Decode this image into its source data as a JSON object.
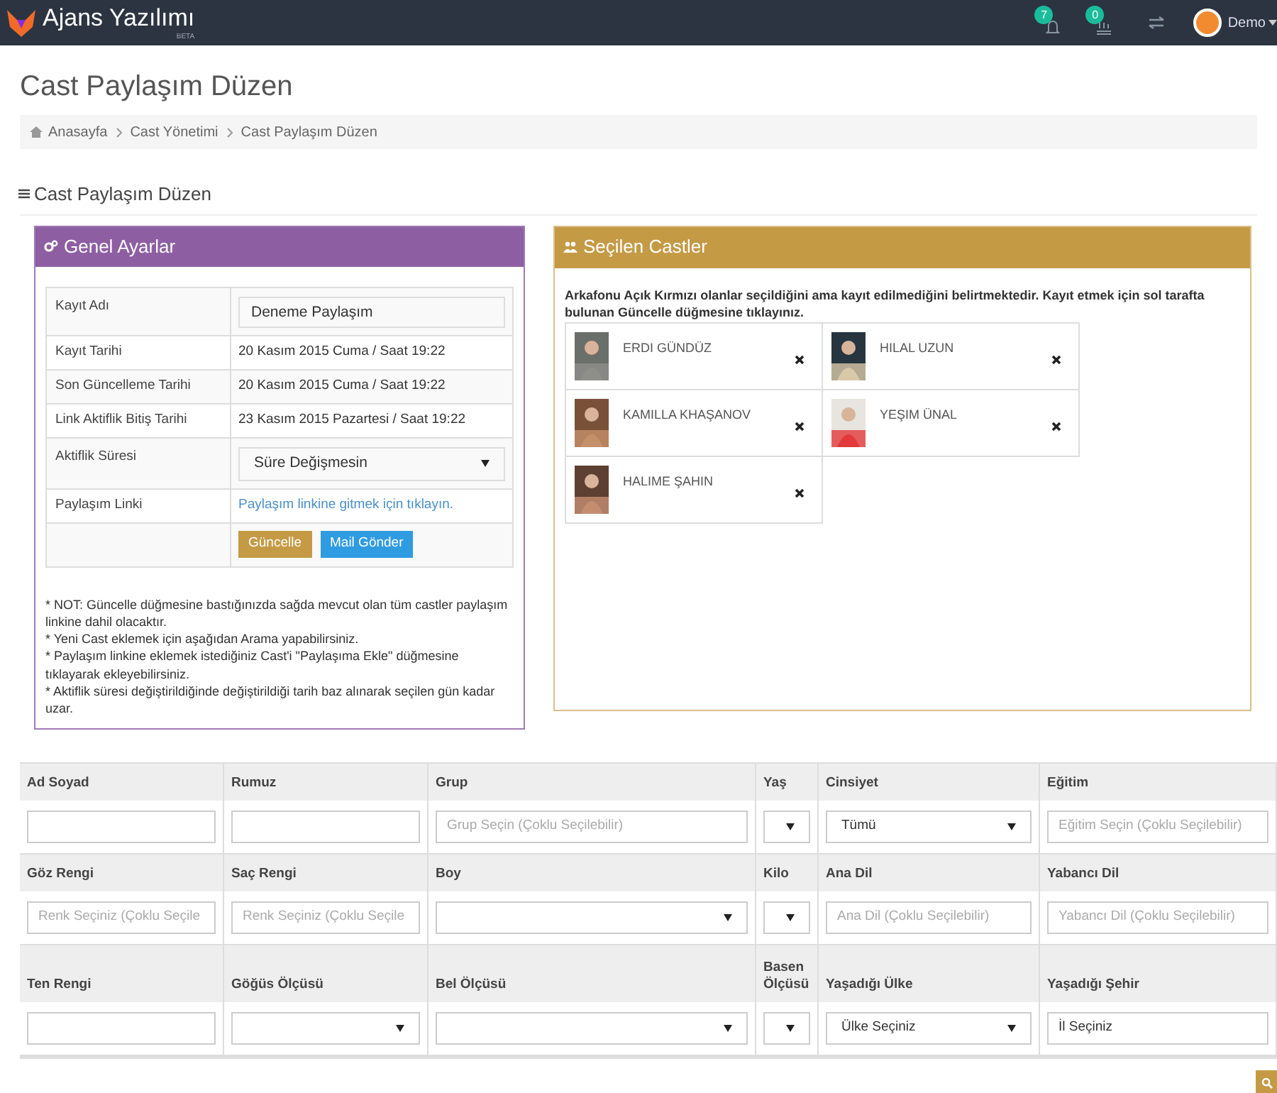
{
  "navbar": {
    "brand": "Ajans Yazılımı",
    "brand_badge": "BETA",
    "notifications": [
      {
        "count": "7"
      },
      {
        "count": "0"
      }
    ],
    "user": "Demo"
  },
  "page_title": "Cast Paylaşım Düzen",
  "breadcrumb": [
    "Anasayfa",
    "Cast Yönetimi",
    "Cast Paylaşım Düzen"
  ],
  "section_title": "Cast Paylaşım Düzen",
  "settings_panel": {
    "title": "Genel Ayarlar",
    "rows": [
      {
        "label": "Kayıt Adı",
        "kind": "input",
        "value": "Deneme Paylaşım"
      },
      {
        "label": "Kayıt Tarihi",
        "kind": "text",
        "value": "20 Kasım 2015 Cuma / Saat 19:22"
      },
      {
        "label": "Son Güncelleme Tarihi",
        "kind": "text",
        "value": "20 Kasım 2015 Cuma / Saat 19:22"
      },
      {
        "label": "Link Aktiflik Bitiş Tarihi",
        "kind": "text",
        "value": "23 Kasım 2015 Pazartesi / Saat 19:22"
      },
      {
        "label": "Aktiflik Süresi",
        "kind": "select",
        "value": "Süre Değişmesin"
      },
      {
        "label": "Paylaşım Linki",
        "kind": "link",
        "value": "Paylaşım linkine gitmek için tıklayın."
      }
    ],
    "buttons": [
      {
        "label": "Güncelle",
        "kind": "primary"
      },
      {
        "label": "Mail Gönder",
        "kind": "info"
      }
    ],
    "notes": [
      "* NOT: Güncelle düğmesine bastığınızda sağda mevcut olan tüm castler paylaşım linkine dahil olacaktır.",
      "* Yeni Cast eklemek için aşağıdan Arama yapabilirsiniz.",
      "* Paylaşım linkine eklemek istediğiniz Cast'i \"Paylaşıma Ekle\" düğmesine tıklayarak ekleyebilirsiniz.",
      "* Aktiflik süresi değiştirildiğinde değiştirildiği tarih baz alınarak seçilen gün kadar uzar."
    ]
  },
  "casts_panel": {
    "title": "Seçilen Castler",
    "info": "Arkafonu Açık Kırmızı olanlar seçildiğini ama kayıt edilmediğini belirtmektedir. Kayıt etmek için sol tarafta bulunan Güncelle düğmesine tıklayınız.",
    "casts": [
      {
        "name": "ERDI GÜNDÜZ"
      },
      {
        "name": "HILAL UZUN"
      },
      {
        "name": "KAMILLA KHAŞANOV"
      },
      {
        "name": "YEŞIM ÜNAL"
      },
      {
        "name": "HALIME ŞAHIN"
      }
    ]
  },
  "filters": [
    [
      {
        "label": "Ad Soyad",
        "kind": "input"
      },
      {
        "label": "Rumuz",
        "kind": "input"
      },
      {
        "label": "Grup",
        "kind": "input",
        "placeholder": "Grup Seçin (Çoklu Seçilebilir)"
      },
      {
        "label": "Yaş",
        "kind": "select"
      },
      {
        "label": "Cinsiyet",
        "kind": "select",
        "value": "Tümü"
      },
      {
        "label": "Eğitim",
        "kind": "input",
        "placeholder": "Eğitim Seçin (Çoklu Seçilebilir)"
      }
    ],
    [
      {
        "label": "Göz Rengi",
        "kind": "input",
        "placeholder": "Renk Seçiniz (Çoklu Seçile"
      },
      {
        "label": "Saç Rengi",
        "kind": "input",
        "placeholder": "Renk Seçiniz (Çoklu Seçile"
      },
      {
        "label": "Boy",
        "kind": "select"
      },
      {
        "label": "Kilo",
        "kind": "select"
      },
      {
        "label": "Ana Dil",
        "kind": "input",
        "placeholder": "Ana Dil (Çoklu Seçilebilir)"
      },
      {
        "label": "Yabancı Dil",
        "kind": "input",
        "placeholder": "Yabancı Dil (Çoklu Seçilebilir)"
      }
    ],
    [
      {
        "label": "Ten Rengi",
        "kind": "input"
      },
      {
        "label": "Göğüs Ölçüsü",
        "kind": "select"
      },
      {
        "label": "Bel Ölçüsü",
        "kind": "select"
      },
      {
        "label": "Basen Ölçüsü",
        "kind": "select"
      },
      {
        "label": "Yaşadığı Ülke",
        "kind": "select",
        "value": "Ülke Seçiniz"
      },
      {
        "label": "Yaşadığı Şehir",
        "kind": "input",
        "value": "İl Seçiniz"
      }
    ]
  ]
}
